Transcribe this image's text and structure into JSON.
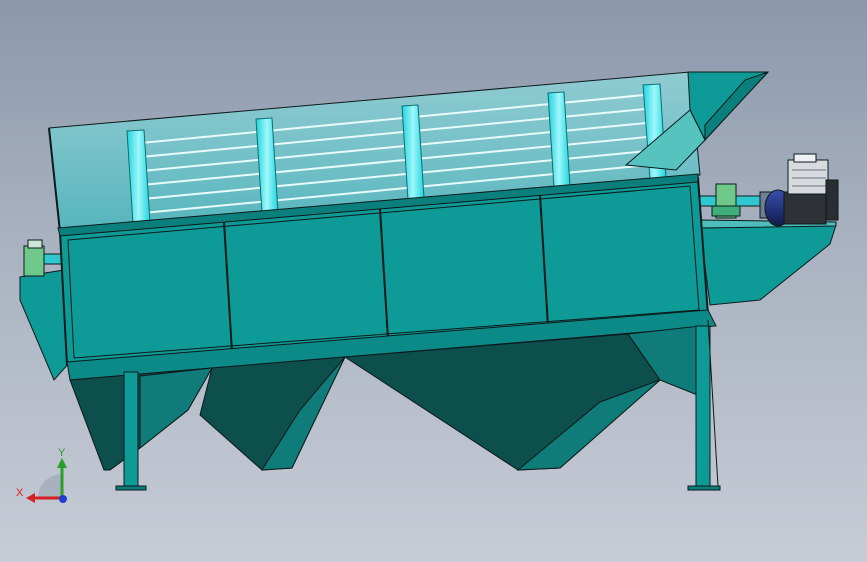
{
  "view": {
    "background_top": "#8b98ac",
    "background_bottom": "#c7ccd6"
  },
  "triad": {
    "x_label": "X",
    "y_label": "Y",
    "x_color": "#d42020",
    "y_color": "#2aa02a",
    "z_color": "#1f3fd1"
  },
  "colors": {
    "body": "#0e9b98",
    "body_dark": "#0b7f7c",
    "hopper_shadow": "#0c4f4d",
    "hopper_light": "#0f7c79",
    "screen_glass": "#6fc9cf",
    "ring": "#2ae8f0",
    "outline": "#0b1a1a",
    "motor": "#1b2a6a",
    "gearbox": "#d7dbe0"
  }
}
